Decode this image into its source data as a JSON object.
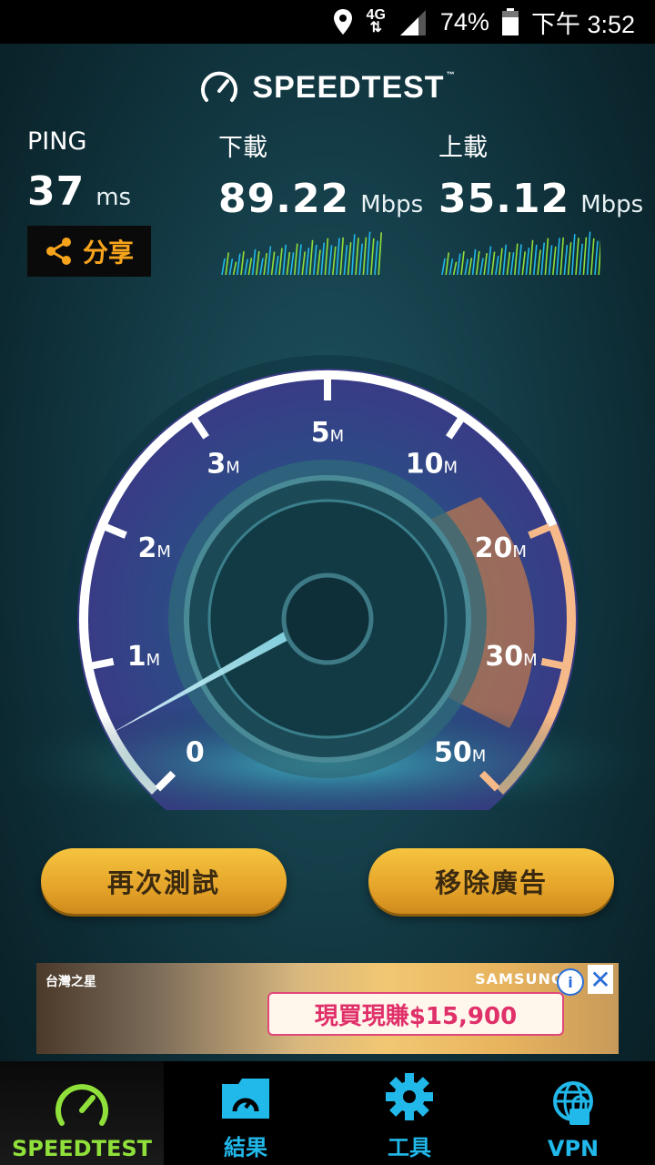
{
  "status_bar": {
    "network": "4G",
    "battery": "74%",
    "time": "下午 3:52"
  },
  "app": {
    "title": "SPEEDTEST",
    "trademark": "™"
  },
  "results": {
    "ping": {
      "label": "PING",
      "value": "37",
      "unit": "ms"
    },
    "download": {
      "label": "下載",
      "value": "89.22",
      "unit": "Mbps"
    },
    "upload": {
      "label": "上載",
      "value": "35.12",
      "unit": "Mbps"
    }
  },
  "share_label": "分享",
  "gauge": {
    "ticks": [
      {
        "num": "0",
        "unit": ""
      },
      {
        "num": "1",
        "unit": "M"
      },
      {
        "num": "2",
        "unit": "M"
      },
      {
        "num": "3",
        "unit": "M"
      },
      {
        "num": "5",
        "unit": "M"
      },
      {
        "num": "10",
        "unit": "M"
      },
      {
        "num": "20",
        "unit": "M"
      },
      {
        "num": "30",
        "unit": "M"
      },
      {
        "num": "50",
        "unit": "M"
      }
    ],
    "needle_value": "0",
    "accent_color": "#b88cf0",
    "warn_color": "#f08a3a"
  },
  "buttons": {
    "retest": "再次測試",
    "remove_ads": "移除廣告"
  },
  "ad": {
    "tag": "台灣之星",
    "brand": "SAMSUNG",
    "promo": "現買現賺$15,900"
  },
  "tabs": [
    {
      "label": "SPEEDTEST",
      "icon": "speedometer-icon"
    },
    {
      "label": "結果",
      "icon": "results-folder-icon"
    },
    {
      "label": "工具",
      "icon": "gear-icon"
    },
    {
      "label": "VPN",
      "icon": "globe-lock-icon"
    }
  ]
}
